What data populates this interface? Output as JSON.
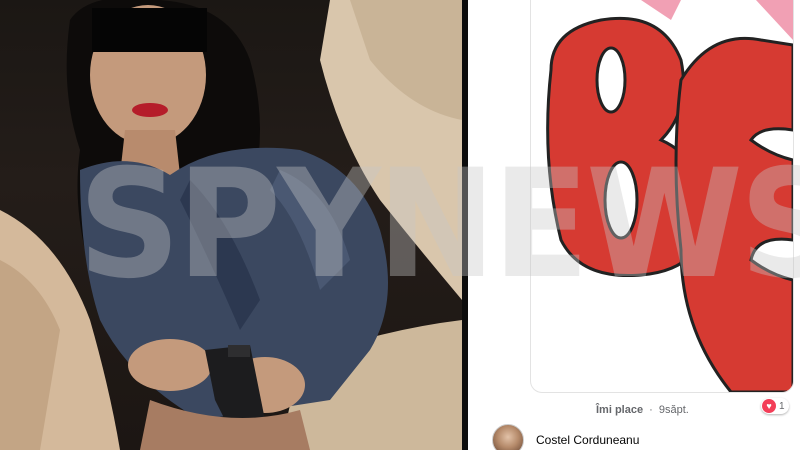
{
  "watermark": {
    "text": "SPYNEWS"
  },
  "post": {
    "like_label": "Îmi place",
    "separator": "·",
    "time": "9săpt.",
    "reaction_count": "1",
    "reaction_icon": "heart-icon",
    "artwork_letters": "BE"
  },
  "comment": {
    "author": "Costel Corduneanu"
  },
  "colors": {
    "artwork_red": "#d63a32",
    "reaction_red": "#f33e58"
  }
}
